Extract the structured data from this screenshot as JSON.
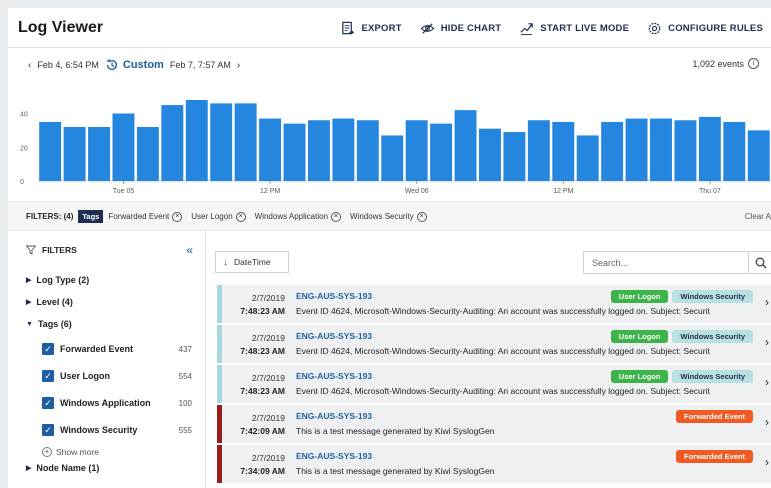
{
  "app": {
    "title": "Log Viewer"
  },
  "toolbar": {
    "export_label": "EXPORT",
    "hide_chart_label": "HIDE CHART",
    "start_live_label": "START LIVE MODE",
    "configure_label": "CONFIGURE RULES"
  },
  "timerange": {
    "start": "Feb 4, 6:54 PM",
    "mode": "Custom",
    "end": "Feb 7, 7:57 AM",
    "events_count": "1,092 events"
  },
  "chart_data": {
    "type": "bar",
    "ylim": [
      0,
      48
    ],
    "yticks": [
      "0",
      "20",
      "40"
    ],
    "xticks": [
      {
        "label": "Tue 05",
        "index": 3
      },
      {
        "label": "12 PM",
        "index": 9
      },
      {
        "label": "Wed 06",
        "index": 15
      },
      {
        "label": "12 PM",
        "index": 21
      },
      {
        "label": "Thu 07",
        "index": 27
      }
    ],
    "values": [
      35,
      32,
      32,
      40,
      32,
      45,
      48,
      46,
      46,
      37,
      34,
      36,
      37,
      36,
      27,
      36,
      34,
      42,
      31,
      29,
      36,
      35,
      27,
      35,
      37,
      37,
      36,
      38,
      35,
      30
    ],
    "colors": {
      "bar": "#2586e0"
    }
  },
  "filters_bar": {
    "label": "FILTERS: (4)",
    "tags_label": "Tags",
    "chips": [
      "Forwarded Event",
      "User Logon",
      "Windows Application",
      "Windows Security"
    ],
    "clear_label": "Clear A"
  },
  "sidebar": {
    "heading": "FILTERS",
    "items": [
      {
        "label": "Log Type (2)"
      },
      {
        "label": "Level (4)"
      },
      {
        "label": "Tags (6)"
      },
      {
        "label": "Node Name (1)"
      }
    ],
    "tags": [
      {
        "name": "Forwarded Event",
        "count": "437"
      },
      {
        "name": "User Logon",
        "count": "554"
      },
      {
        "name": "Windows Application",
        "count": "100"
      },
      {
        "name": "Windows Security",
        "count": "555"
      }
    ],
    "show_more": "Show more"
  },
  "list": {
    "sort_label": "DateTime",
    "search_placeholder": "Search...",
    "rows": [
      {
        "date": "2/7/2019",
        "time": "7:48:23 AM",
        "host": "ENG-AUS-SYS-193",
        "message": "Event ID 4624, Microsoft-Windows-Security-Auditing: An account was successfully logged on. Subject: Securit",
        "badges": [
          "User Logon",
          "Windows Security"
        ],
        "level_color": "#a9d6dc"
      },
      {
        "date": "2/7/2019",
        "time": "7:48:23 AM",
        "host": "ENG-AUS-SYS-193",
        "message": "Event ID 4624, Microsoft-Windows-Security-Auditing: An account was successfully logged on. Subject: Securit",
        "badges": [
          "User Logon",
          "Windows Security"
        ],
        "level_color": "#a9d6dc"
      },
      {
        "date": "2/7/2019",
        "time": "7:48:23 AM",
        "host": "ENG-AUS-SYS-193",
        "message": "Event ID 4624, Microsoft-Windows-Security-Auditing: An account was successfully logged on. Subject: Securit",
        "badges": [
          "User Logon",
          "Windows Security"
        ],
        "level_color": "#a9d6dc"
      },
      {
        "date": "2/7/2019",
        "time": "7:42:09 AM",
        "host": "ENG-AUS-SYS-193",
        "message": "This is a test message generated by Kiwi SyslogGen",
        "badges": [
          "Forwarded Event"
        ],
        "level_color": "#9b1c1c"
      },
      {
        "date": "2/7/2019",
        "time": "7:34:09 AM",
        "host": "ENG-AUS-SYS-193",
        "message": "This is a test message generated by Kiwi SyslogGen",
        "badges": [
          "Forwarded Event"
        ],
        "level_color": "#9b1c1c"
      }
    ]
  }
}
